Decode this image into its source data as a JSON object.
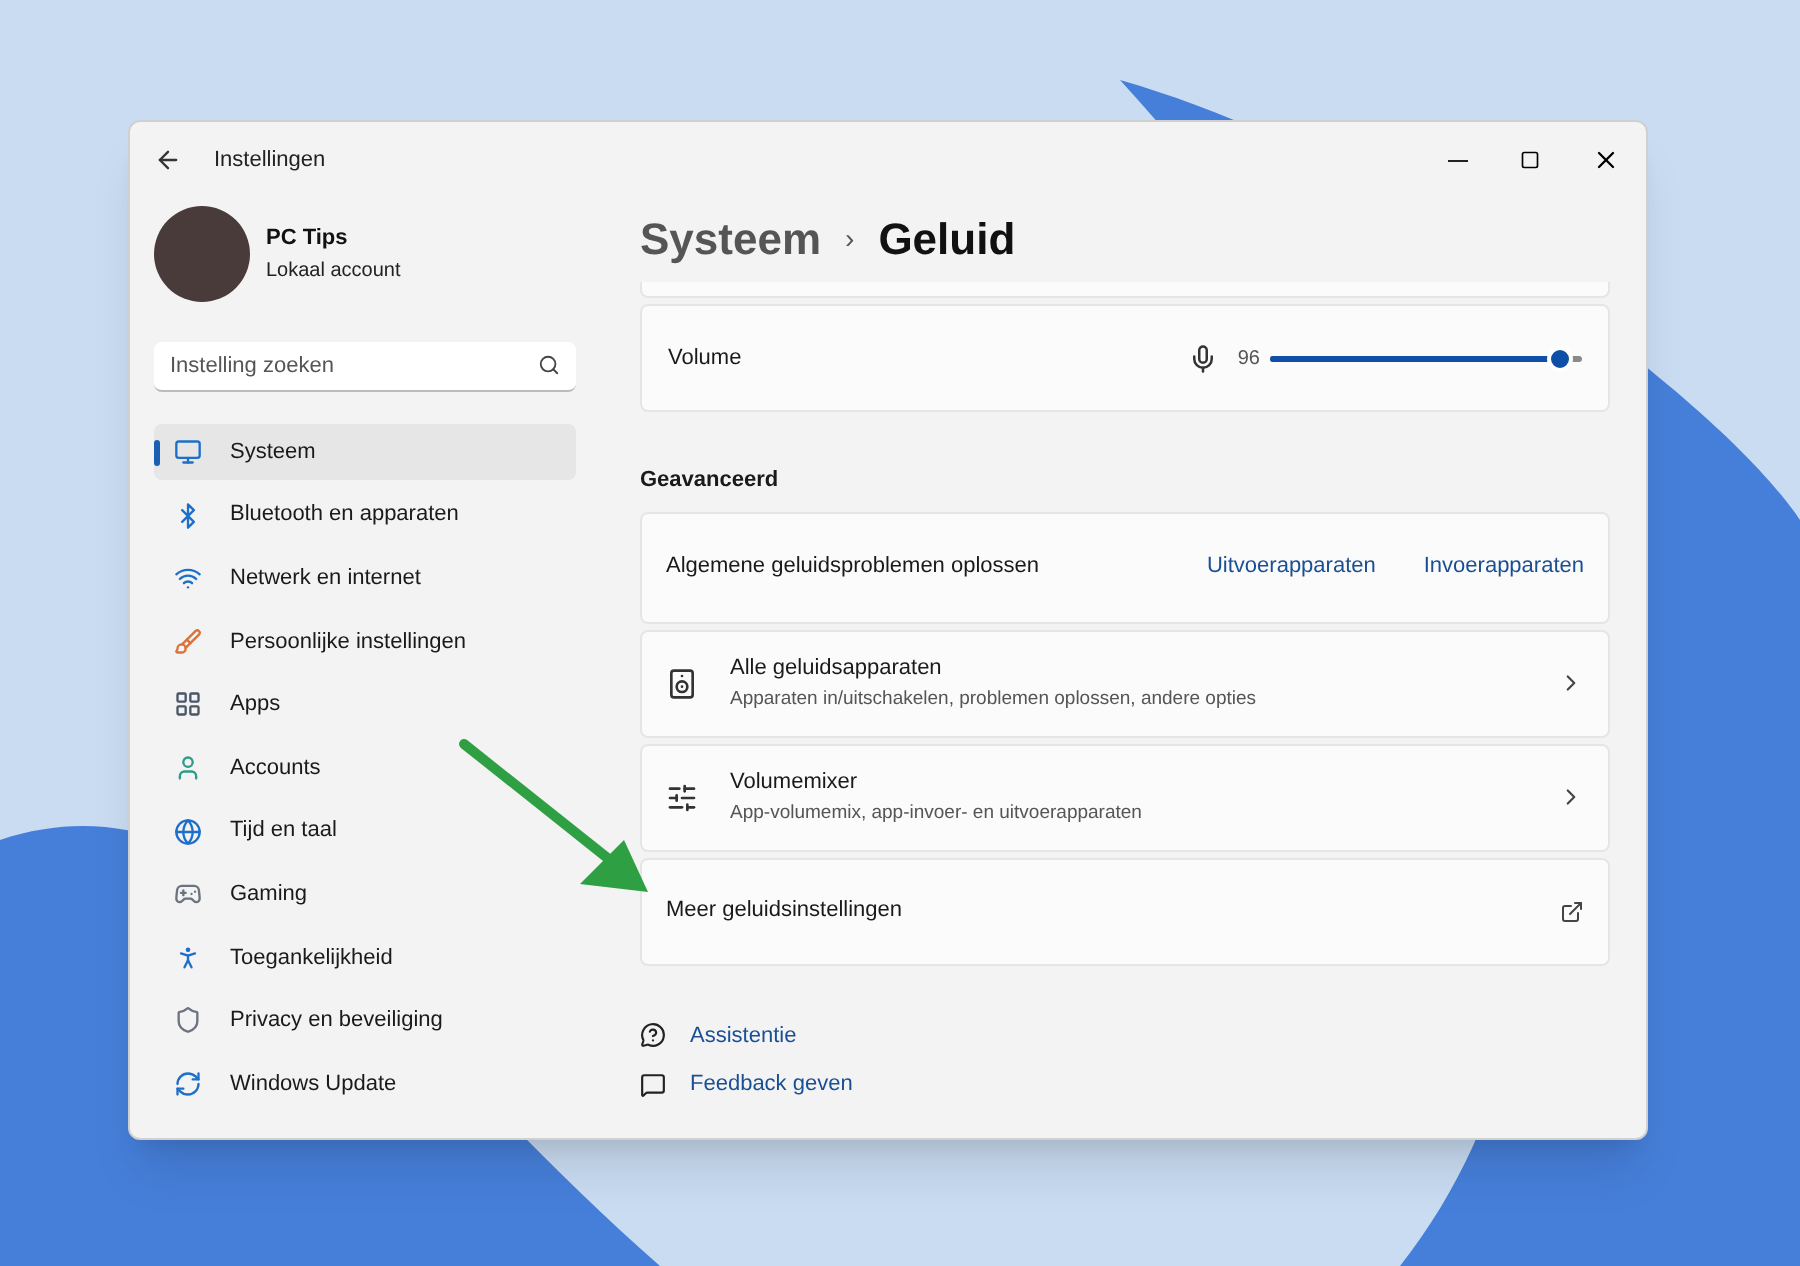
{
  "window": {
    "title": "Instellingen"
  },
  "profile": {
    "name": "PC Tips",
    "account": "Lokaal account"
  },
  "search": {
    "placeholder": "Instelling zoeken"
  },
  "sidebar": {
    "items": [
      {
        "label": "Systeem",
        "kind": "system",
        "selected": true
      },
      {
        "label": "Bluetooth en apparaten",
        "kind": "bluetooth",
        "selected": false
      },
      {
        "label": "Netwerk en internet",
        "kind": "network",
        "selected": false
      },
      {
        "label": "Persoonlijke instellingen",
        "kind": "brush",
        "selected": false
      },
      {
        "label": "Apps",
        "kind": "apps",
        "selected": false
      },
      {
        "label": "Accounts",
        "kind": "accounts",
        "selected": false
      },
      {
        "label": "Tijd en taal",
        "kind": "time",
        "selected": false
      },
      {
        "label": "Gaming",
        "kind": "gaming",
        "selected": false
      },
      {
        "label": "Toegankelijkheid",
        "kind": "accessibility",
        "selected": false
      },
      {
        "label": "Privacy en beveiliging",
        "kind": "privacy",
        "selected": false
      },
      {
        "label": "Windows Update",
        "kind": "update",
        "selected": false
      }
    ]
  },
  "breadcrumb": {
    "parent": "Systeem",
    "separator": "›",
    "current": "Geluid"
  },
  "volume": {
    "label": "Volume",
    "reading": "96",
    "level": 0.93
  },
  "section_title": "Geavanceerd",
  "troubleshoot": {
    "label": "Algemene geluidsproblemen oplossen",
    "links": [
      "Uitvoerapparaten",
      "Invoerapparaten"
    ]
  },
  "rows": [
    {
      "kind": "speaker",
      "title": "Alle geluidsapparaten",
      "subtitle": "Apparaten in/uitschakelen, problemen oplossen, andere opties",
      "opens_external": false
    },
    {
      "kind": "mixer",
      "title": "Volumemixer",
      "subtitle": "App-volumemix, app-invoer- en uitvoerapparaten",
      "opens_external": false
    },
    {
      "kind": "none",
      "title": "Meer geluidsinstellingen",
      "opens_external": true
    }
  ],
  "footer_links": [
    {
      "kind": "help",
      "label": "Assistentie"
    },
    {
      "kind": "feedback",
      "label": "Feedback geven"
    }
  ]
}
